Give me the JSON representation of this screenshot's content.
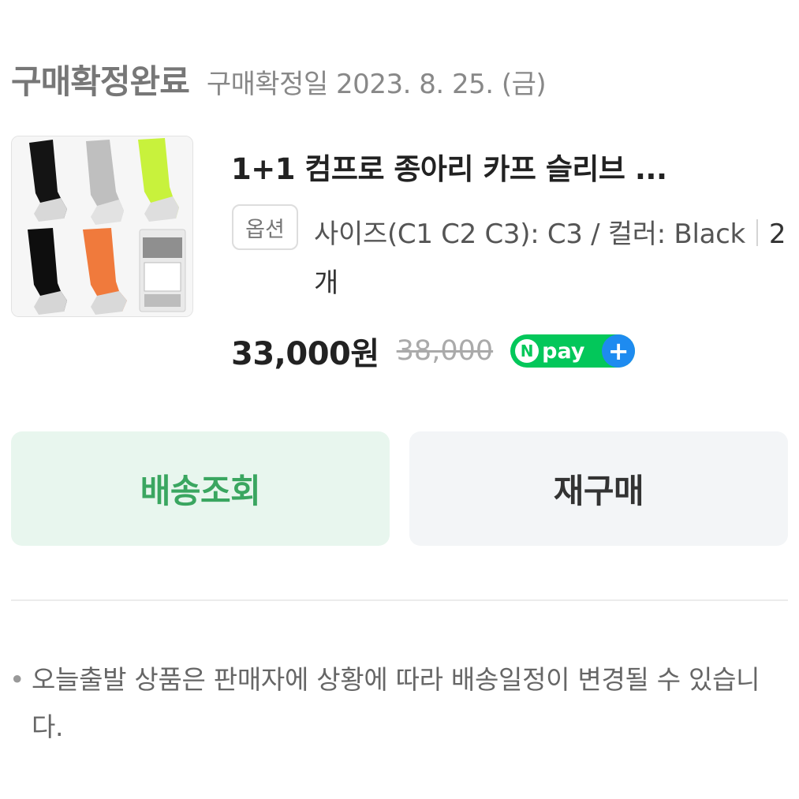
{
  "header": {
    "status": "구매확정완료",
    "confirm_date": "구매확정일 2023. 8. 25. (금)"
  },
  "product": {
    "name": "1+1 컴프로 종아리 카프 슬리브 ...",
    "option_badge": "옵션",
    "option_text": "사이즈(C1 C2 C3): C3 / 컬러: Black",
    "quantity": "2개",
    "price": "33,000원",
    "original_price": "38,000",
    "npay_n": "N",
    "npay_label": "pay",
    "npay_plus": "+"
  },
  "buttons": {
    "track": "배송조회",
    "rebuy": "재구매"
  },
  "notice": {
    "bullet": "•",
    "text": "오늘출발 상품은 판매자에 상황에 따라 배송일정이 변경될 수 있습니다."
  },
  "colors": {
    "track_bg": "#e8f6ee",
    "track_text": "#3aa660",
    "npay_green": "#03c75a",
    "npay_blue": "#1e8bf0"
  },
  "icons": [
    "npay-logo-icon"
  ]
}
